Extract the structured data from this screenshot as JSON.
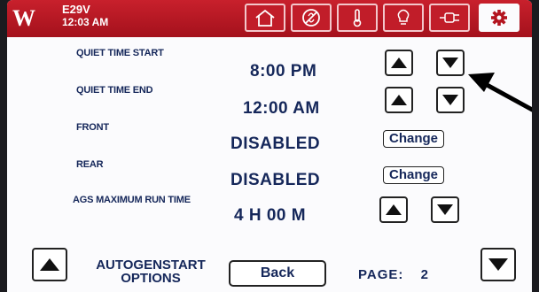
{
  "header": {
    "logo": "W",
    "status_code": "E29V",
    "status_time": "12:03 AM",
    "icons": [
      "home-icon",
      "no-fan-icon",
      "thermometer-icon",
      "lightbulb-icon",
      "plug-icon",
      "gear-icon"
    ],
    "accent_color": "#b3141f"
  },
  "rows": [
    {
      "label": "QUIET TIME START",
      "value": "8:00 PM"
    },
    {
      "label": "QUIET TIME END",
      "value": "12:00 AM"
    },
    {
      "label": "FRONT",
      "value": "DISABLED",
      "action": "Change"
    },
    {
      "label": "REAR",
      "value": "DISABLED",
      "action": "Change"
    },
    {
      "label": "AGS MAXIMUM RUN TIME",
      "value": "4 H 00 M"
    }
  ],
  "footer": {
    "title_line1": "AUTOGENSTART",
    "title_line2": "OPTIONS",
    "back_label": "Back",
    "page_label": "PAGE:",
    "page_number": "2"
  },
  "text_color": "#15275a"
}
